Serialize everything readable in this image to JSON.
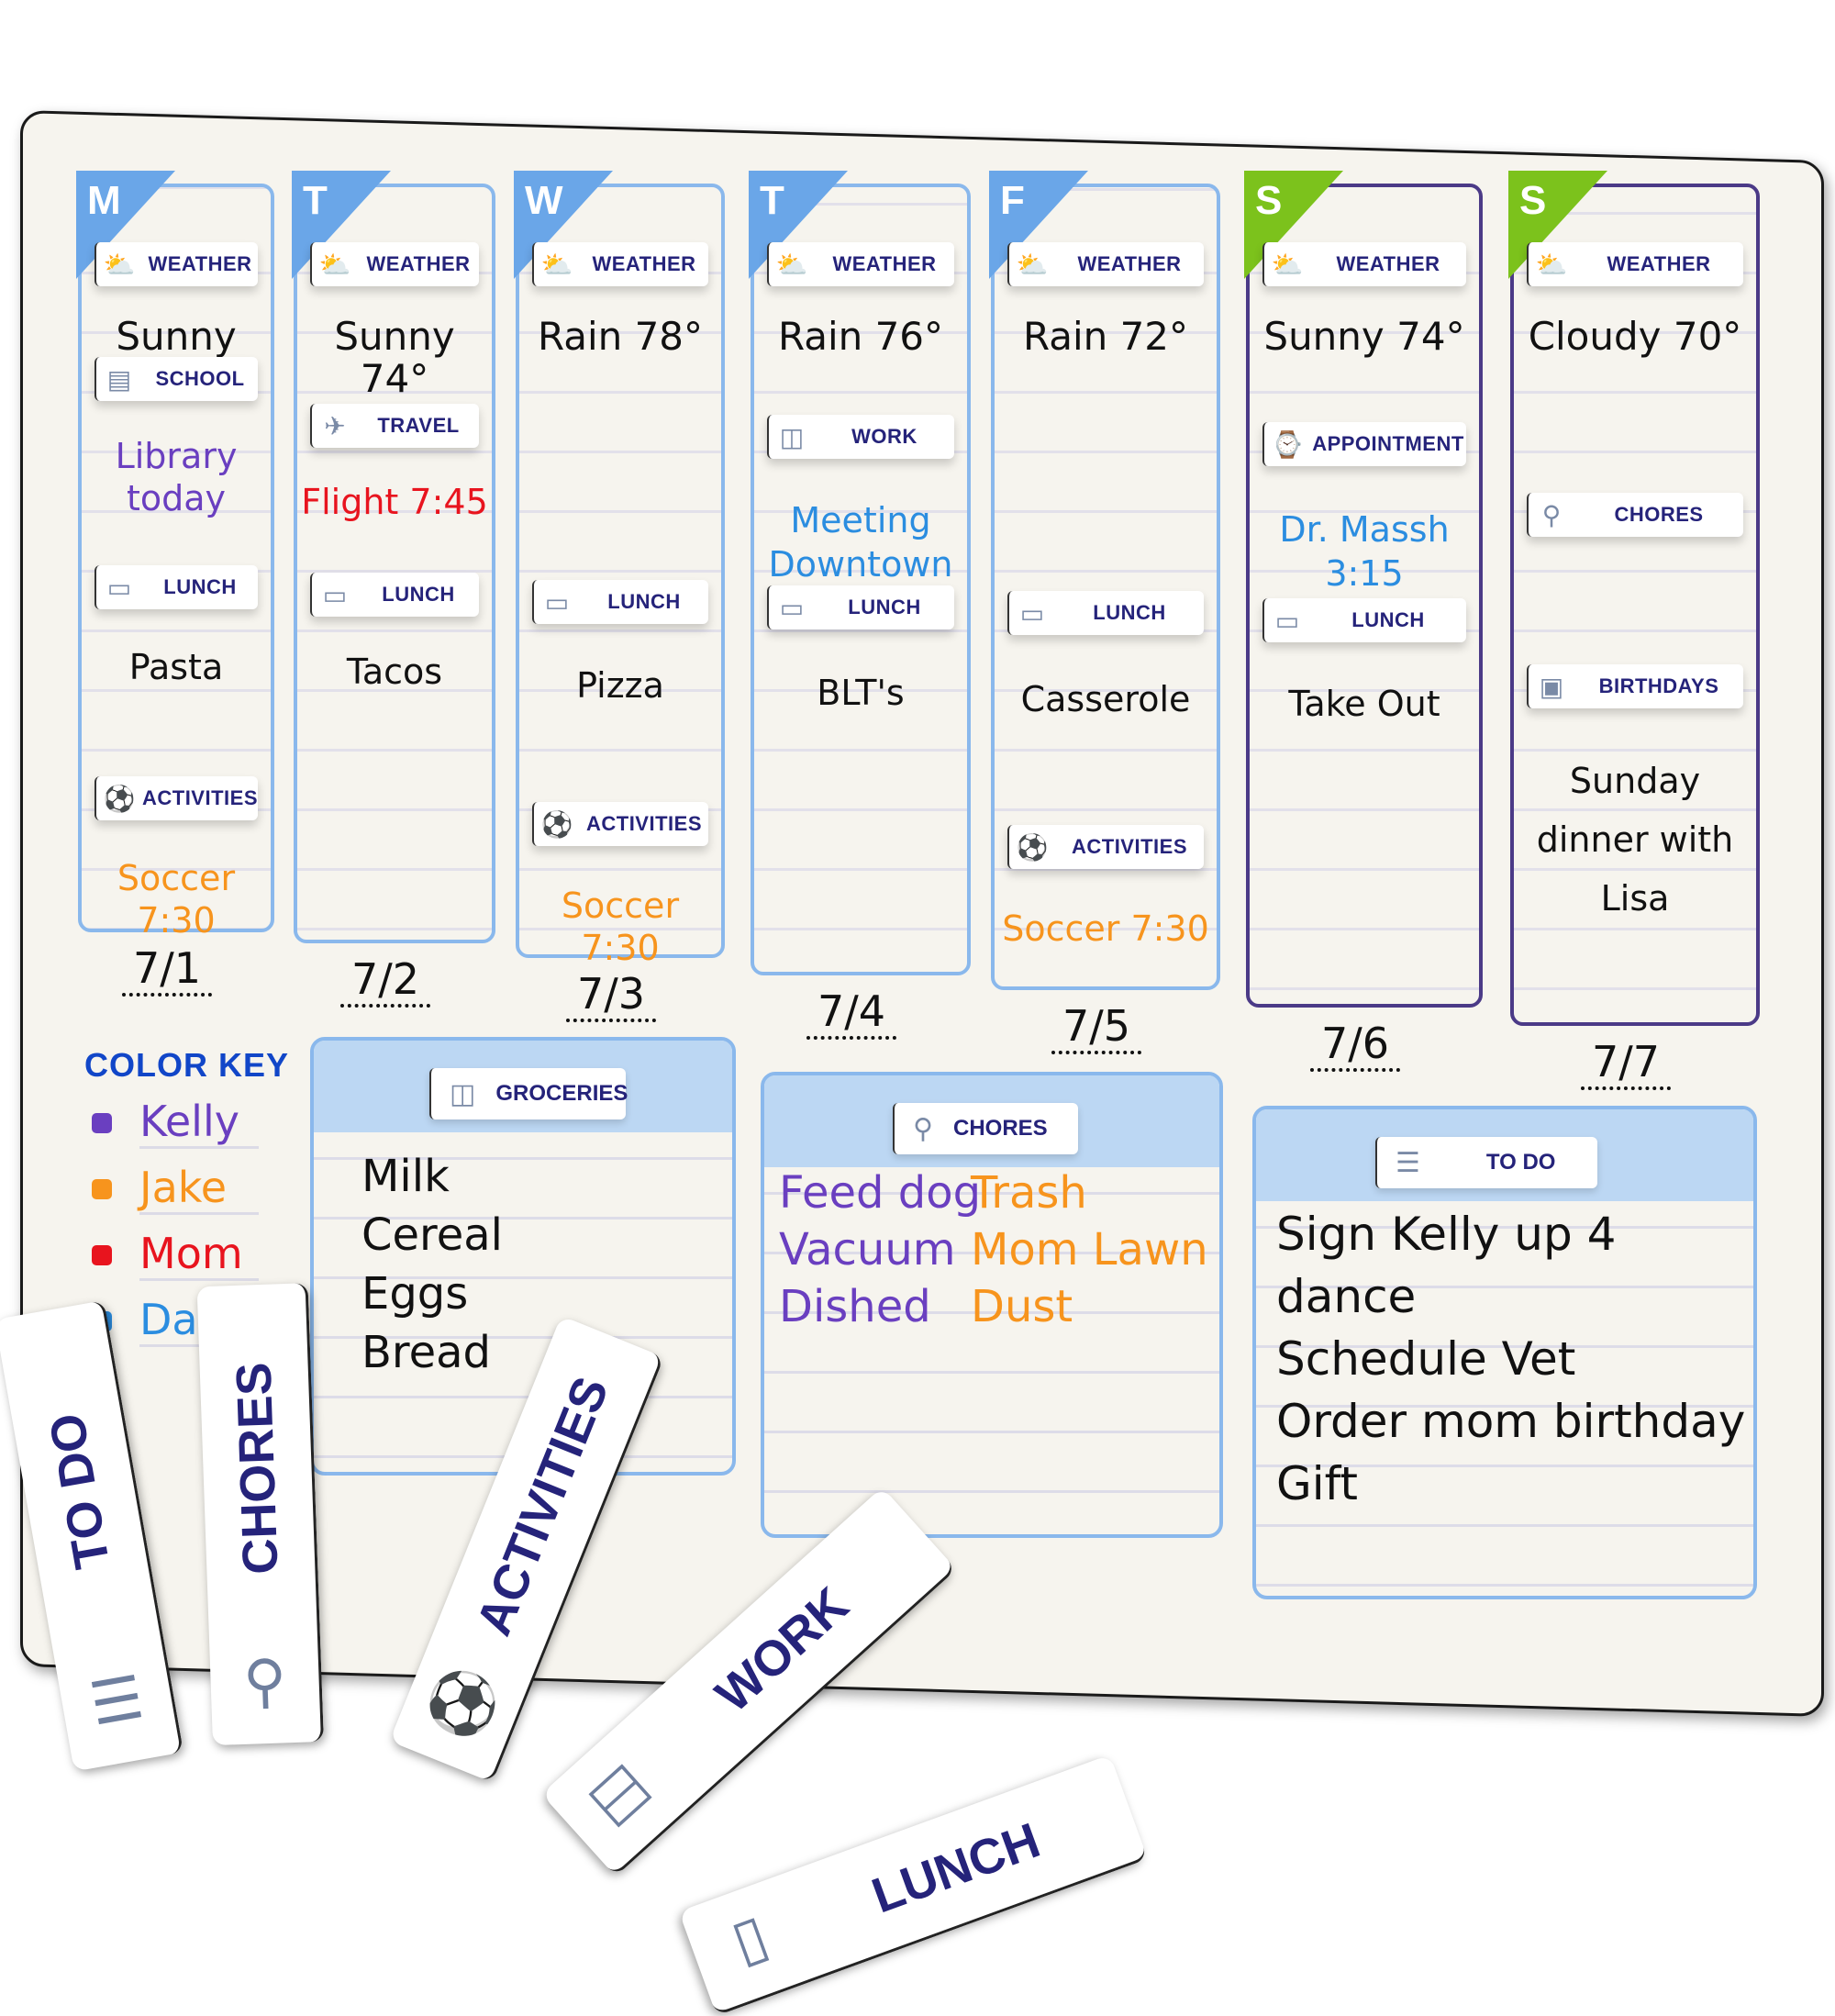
{
  "colors": {
    "kelly": "#6a3fc0",
    "jake": "#f7941d",
    "mom": "#e8141e",
    "dad": "#2b8de0",
    "ink": "#111111",
    "weekday_accent": "#6aa6e8",
    "weekend_accent": "#7cc21c",
    "weekend_border": "#4b3a87",
    "label_text": "#25237a"
  },
  "days": [
    {
      "letter": "M",
      "date": "7/1",
      "weekend": false,
      "items": [
        {
          "type": "label",
          "text": "WEATHER",
          "icon": "weather-icon"
        },
        {
          "type": "text",
          "text": "Sunny 72°",
          "color": "ink"
        },
        {
          "type": "label",
          "text": "SCHOOL",
          "icon": "notebook-icon"
        },
        {
          "type": "text",
          "text": "Library today",
          "color": "kelly"
        },
        {
          "type": "label",
          "text": "LUNCH",
          "icon": "sandwich-icon"
        },
        {
          "type": "text",
          "text": "Pasta",
          "color": "ink"
        },
        {
          "type": "label",
          "text": "ACTIVITIES",
          "icon": "soccer-ball-icon"
        },
        {
          "type": "text",
          "text": "Soccer 7:30",
          "color": "jake"
        }
      ]
    },
    {
      "letter": "T",
      "date": "7/2",
      "weekend": false,
      "items": [
        {
          "type": "label",
          "text": "WEATHER",
          "icon": "weather-icon"
        },
        {
          "type": "text",
          "text": "Sunny 74°",
          "color": "ink"
        },
        {
          "type": "label",
          "text": "TRAVEL",
          "icon": "airplane-icon"
        },
        {
          "type": "text",
          "text": "Flight 7:45",
          "color": "mom"
        },
        {
          "type": "label",
          "text": "LUNCH",
          "icon": "sandwich-icon"
        },
        {
          "type": "text",
          "text": "Tacos",
          "color": "ink"
        }
      ]
    },
    {
      "letter": "W",
      "date": "7/3",
      "weekend": false,
      "items": [
        {
          "type": "label",
          "text": "WEATHER",
          "icon": "weather-icon"
        },
        {
          "type": "text",
          "text": "Rain 78°",
          "color": "ink"
        },
        {
          "type": "label",
          "text": "LUNCH",
          "icon": "sandwich-icon"
        },
        {
          "type": "text",
          "text": "Pizza",
          "color": "ink"
        },
        {
          "type": "label",
          "text": "ACTIVITIES",
          "icon": "soccer-ball-icon"
        },
        {
          "type": "text",
          "text": "Soccer 7:30",
          "color": "jake"
        }
      ]
    },
    {
      "letter": "T",
      "date": "7/4",
      "weekend": false,
      "items": [
        {
          "type": "label",
          "text": "WEATHER",
          "icon": "weather-icon"
        },
        {
          "type": "text",
          "text": "Rain 76°",
          "color": "ink"
        },
        {
          "type": "label",
          "text": "WORK",
          "icon": "briefcase-icon"
        },
        {
          "type": "text",
          "text": "Meeting",
          "color": "dad"
        },
        {
          "type": "text",
          "text": "Downtown",
          "color": "dad"
        },
        {
          "type": "label",
          "text": "LUNCH",
          "icon": "sandwich-icon"
        },
        {
          "type": "text",
          "text": "BLT's",
          "color": "ink"
        }
      ]
    },
    {
      "letter": "F",
      "date": "7/5",
      "weekend": false,
      "items": [
        {
          "type": "label",
          "text": "WEATHER",
          "icon": "weather-icon"
        },
        {
          "type": "text",
          "text": "Rain 72°",
          "color": "ink"
        },
        {
          "type": "label",
          "text": "LUNCH",
          "icon": "sandwich-icon"
        },
        {
          "type": "text",
          "text": "Casserole",
          "color": "ink"
        },
        {
          "type": "label",
          "text": "ACTIVITIES",
          "icon": "soccer-ball-icon"
        },
        {
          "type": "text",
          "text": "Soccer 7:30",
          "color": "jake"
        }
      ]
    },
    {
      "letter": "S",
      "date": "7/6",
      "weekend": true,
      "items": [
        {
          "type": "label",
          "text": "WEATHER",
          "icon": "weather-icon"
        },
        {
          "type": "text",
          "text": "Sunny 74°",
          "color": "ink"
        },
        {
          "type": "label",
          "text": "APPOINTMENT",
          "icon": "watch-icon"
        },
        {
          "type": "text",
          "text": "Dr. Massh",
          "color": "dad"
        },
        {
          "type": "text",
          "text": "3:15",
          "color": "dad"
        },
        {
          "type": "label",
          "text": "LUNCH",
          "icon": "sandwich-icon"
        },
        {
          "type": "text",
          "text": "Take Out",
          "color": "ink"
        }
      ]
    },
    {
      "letter": "S",
      "date": "7/7",
      "weekend": true,
      "items": [
        {
          "type": "label",
          "text": "WEATHER",
          "icon": "weather-icon"
        },
        {
          "type": "text",
          "text": "Cloudy 70°",
          "color": "ink"
        },
        {
          "type": "label",
          "text": "CHORES",
          "icon": "vacuum-icon"
        },
        {
          "type": "label",
          "text": "BIRTHDAYS",
          "icon": "gift-icon"
        },
        {
          "type": "text",
          "text": "Sunday",
          "color": "ink"
        },
        {
          "type": "text",
          "text": "dinner with",
          "color": "ink"
        },
        {
          "type": "text",
          "text": "Lisa",
          "color": "ink"
        }
      ]
    }
  ],
  "color_key": {
    "title": "COLOR KEY",
    "entries": [
      {
        "name": "Kelly",
        "color": "#6a3fc0"
      },
      {
        "name": "Jake",
        "color": "#f7941d"
      },
      {
        "name": "Mom",
        "color": "#e8141e"
      },
      {
        "name": "Dad",
        "color": "#2b8de0"
      }
    ]
  },
  "groceries": {
    "label": "GROCERIES",
    "icon": "grocery-bag-icon",
    "items": [
      "Milk",
      "Cereal",
      "Eggs",
      "Bread"
    ]
  },
  "chores": {
    "label": "CHORES",
    "icon": "vacuum-icon",
    "items": [
      {
        "text": "Feed dog",
        "color": "kelly"
      },
      {
        "text": "Trash",
        "color": "jake"
      },
      {
        "text": "Vacuum",
        "color": "kelly"
      },
      {
        "text": "Mom Lawn",
        "color": "jake"
      },
      {
        "text": "Dished",
        "color": "kelly"
      },
      {
        "text": "Dust",
        "color": "jake"
      }
    ]
  },
  "todo": {
    "label": "TO DO",
    "icon": "clipboard-icon",
    "items": [
      "Sign Kelly up 4",
      "dance",
      "Schedule Vet",
      "Order mom birthday",
      "Gift"
    ]
  },
  "magnets": [
    {
      "text": "TO DO",
      "icon": "clipboard-icon"
    },
    {
      "text": "CHORES",
      "icon": "vacuum-icon"
    },
    {
      "text": "ACTIVITIES",
      "icon": "soccer-ball-icon"
    },
    {
      "text": "WORK",
      "icon": "briefcase-icon"
    },
    {
      "text": "LUNCH",
      "icon": "sandwich-icon"
    }
  ]
}
